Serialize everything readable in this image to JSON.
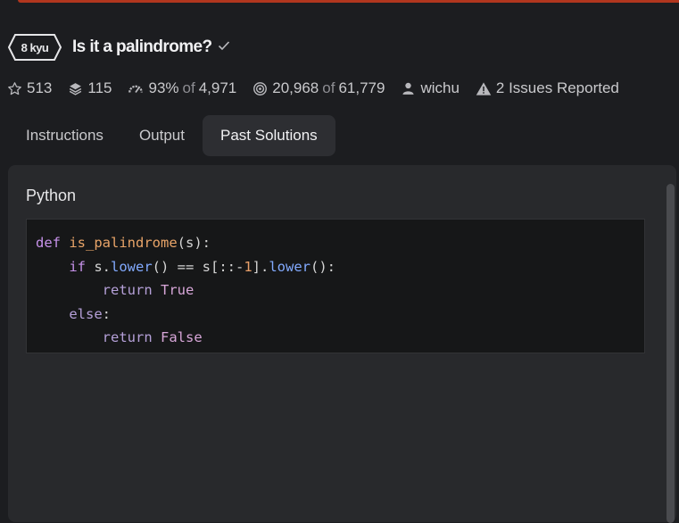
{
  "kata": {
    "rank": "8 kyu",
    "title": "Is it a palindrome?"
  },
  "stats": {
    "stars": "513",
    "collections": "115",
    "satisfaction": "93%",
    "satisfaction_of": "of",
    "satisfaction_votes": "4,971",
    "completed": "20,968",
    "completed_of": "of",
    "attempts": "61,779",
    "author": "wichu",
    "issues": "2 Issues Reported"
  },
  "tabs": [
    {
      "label": "Instructions",
      "active": false
    },
    {
      "label": "Output",
      "active": false
    },
    {
      "label": "Past Solutions",
      "active": true
    }
  ],
  "solution": {
    "language": "Python",
    "code_lines": [
      "def is_palindrome(s):",
      "    if s.lower() == s[::-1].lower():",
      "        return True",
      "    else:",
      "        return False"
    ]
  },
  "colors": {
    "accent_bar": "#b1361e",
    "background": "#1c1d20",
    "panel": "#28292c",
    "code_bg": "#161718"
  }
}
